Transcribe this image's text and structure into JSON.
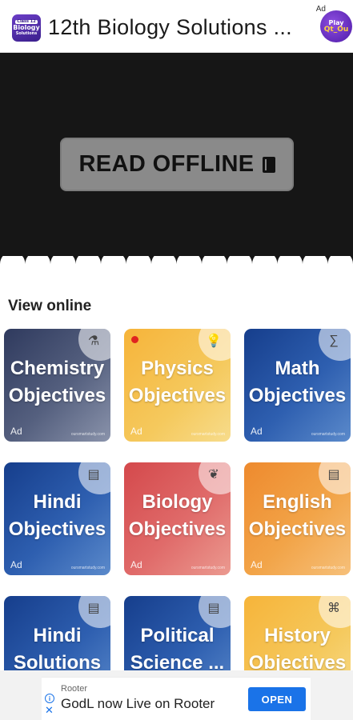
{
  "app_bar": {
    "logo_lines": [
      "Class 12",
      "Biology",
      "Solutions"
    ],
    "title": "12th Biology Solutions ...",
    "ad_label": "Ad",
    "promo_badge": {
      "line1": "Play",
      "line2": "Qt_Ou"
    }
  },
  "hero": {
    "button_label": "READ OFFLINE",
    "button_icon": "book-icon",
    "background": "#161616",
    "button_color": "#8a8a8a"
  },
  "section": {
    "title": "View online"
  },
  "tiles": [
    {
      "line1": "Chemistry",
      "line2": "Objectives",
      "ad": "Ad",
      "site": "oursmartstudy.com",
      "icon": "chemistry-flask-icon",
      "theme": "slate"
    },
    {
      "line1": "Physics",
      "line2": "Objectives",
      "ad": "Ad",
      "site": "oursmartstudy.com",
      "icon": "lightbulb-icon",
      "theme": "yellow",
      "dot": true
    },
    {
      "line1": "Math",
      "line2": "Objectives",
      "ad": "Ad",
      "site": "oursmartstudy.com",
      "icon": "math-graph-icon",
      "theme": "blue"
    },
    {
      "line1": "Hindi",
      "line2": "Objectives",
      "ad": "Ad",
      "site": "oursmartstudy.com",
      "icon": "hindi-book-icon",
      "theme": "blue"
    },
    {
      "line1": "Biology",
      "line2": "Objectives",
      "ad": "Ad",
      "site": "oursmartstudy.com",
      "icon": "lungs-icon",
      "theme": "red"
    },
    {
      "line1": "English",
      "line2": "Objectives",
      "ad": "Ad",
      "site": "oursmartstudy.com",
      "icon": "english-book-icon",
      "theme": "orange"
    },
    {
      "line1": "Hindi",
      "line2": "Solutions",
      "icon": "hindi-book-icon",
      "theme": "blue"
    },
    {
      "line1": "Political",
      "line2": "Science ...",
      "icon": "political-science-book-icon",
      "theme": "blue"
    },
    {
      "line1": "History",
      "line2": "Objectives",
      "icon": "history-scroll-icon",
      "theme": "yellow"
    }
  ],
  "bottom_ad": {
    "advertiser": "Rooter",
    "headline": "GodL now Live on Rooter",
    "cta": "OPEN",
    "info_icon": "info-icon",
    "close_icon": "close-icon",
    "cta_color": "#1a73e8"
  }
}
